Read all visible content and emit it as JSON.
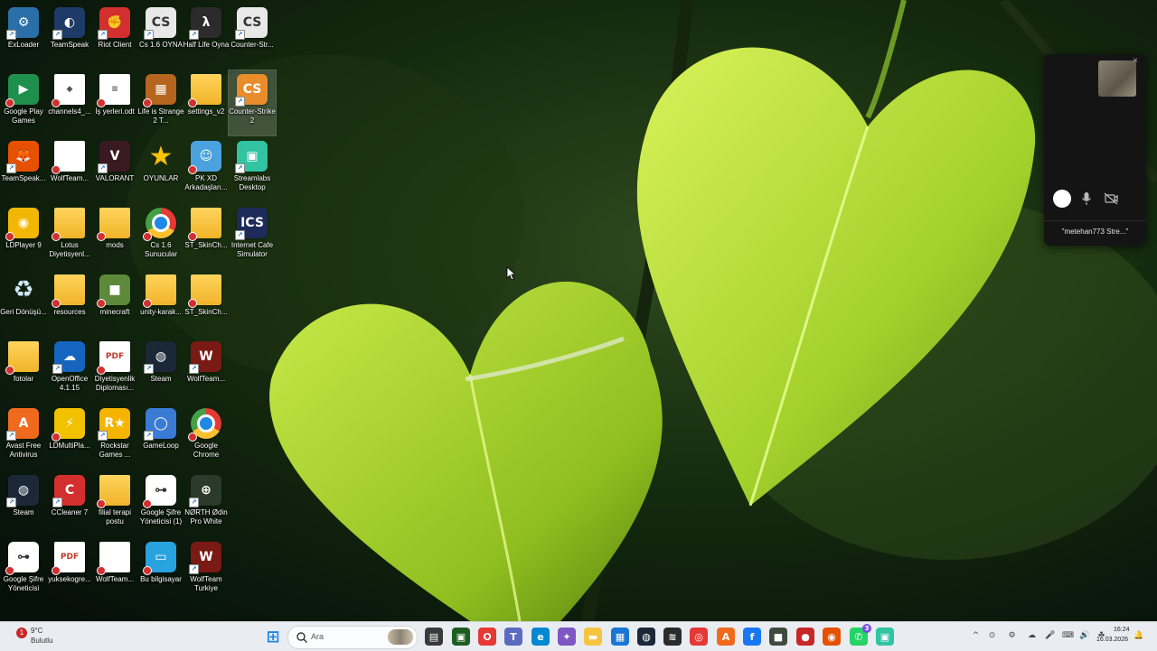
{
  "desktop": {
    "icons": [
      {
        "label": "ExLoader",
        "color": "#2a6fa8",
        "glyph": "⚙",
        "shortcut": true
      },
      {
        "label": "TeamSpeak",
        "color": "#1e3a66",
        "glyph": "◐",
        "shortcut": true
      },
      {
        "label": "Riot Client",
        "color": "#d32f2f",
        "glyph": "✊",
        "shortcut": true
      },
      {
        "label": "Cs 1.6 OYNA",
        "color": "#e8e8e8",
        "glyph": "CS",
        "shortcut": true,
        "dark": true
      },
      {
        "label": "Half Life Oyna",
        "color": "#2b2b2b",
        "glyph": "λ",
        "shortcut": true
      },
      {
        "label": "Counter-Str...",
        "color": "#e8e8e8",
        "glyph": "CS",
        "shortcut": true,
        "dark": true
      },
      {
        "label": "Google Play Games",
        "color": "#1f8f4e",
        "glyph": "▶",
        "shortcut": false
      },
      {
        "label": "channels4_...",
        "color": "#ffffff",
        "glyph": "◆",
        "doc": true
      },
      {
        "label": "İş yerleri.odt",
        "color": "#ffffff",
        "glyph": "≡",
        "doc": true
      },
      {
        "label": "Life is Strange 2 T...",
        "color": "#b5651d",
        "glyph": "▦",
        "shortcut": false
      },
      {
        "label": "settings_v2",
        "color": "#f5c542",
        "glyph": "",
        "folder": true
      },
      {
        "label": "Counter-Strike 2",
        "color": "#e88d2a",
        "glyph": "CS",
        "shortcut": true,
        "selected": true
      },
      {
        "label": "TeamSpeak...",
        "color": "#e65100",
        "glyph": "🦊",
        "shortcut": true
      },
      {
        "label": "WolfTeam...",
        "color": "#ffffff",
        "glyph": "",
        "doc": true
      },
      {
        "label": "VALORANT",
        "color": "#3a1a22",
        "glyph": "V",
        "shortcut": true
      },
      {
        "label": "OYUNLAR",
        "color": "transparent",
        "glyph": "★",
        "star": true
      },
      {
        "label": "PK XD Arkadaşları...",
        "color": "#4aa3df",
        "glyph": "☺",
        "shortcut": false
      },
      {
        "label": "Streamlabs Desktop",
        "color": "#31c3a2",
        "glyph": "▣",
        "shortcut": true
      },
      {
        "label": "LDPlayer 9",
        "color": "#f2b705",
        "glyph": "◉",
        "shortcut": false
      },
      {
        "label": "Lotus Diyetisyenl...",
        "color": "#f5c542",
        "glyph": "",
        "folder": true
      },
      {
        "label": "mods",
        "color": "#f5c542",
        "glyph": "",
        "folder": true
      },
      {
        "label": "Cs 1.6 Sunucular",
        "color": "#ffffff",
        "glyph": "◎",
        "doc": true,
        "chrome": true
      },
      {
        "label": "ST_SkinCh...",
        "color": "#f5c542",
        "glyph": "",
        "folder": true
      },
      {
        "label": "Internet Cafe Simulator",
        "color": "#1d2b5a",
        "glyph": "ICS",
        "shortcut": true
      },
      {
        "label": "Geri Dönüşü...",
        "color": "transparent",
        "glyph": "♻",
        "bin": true
      },
      {
        "label": "resources",
        "color": "#f5c542",
        "glyph": "",
        "folder": true
      },
      {
        "label": "minecraft",
        "color": "#5d8a3a",
        "glyph": "■",
        "shortcut": false
      },
      {
        "label": "unity-karak...",
        "color": "#f5c542",
        "glyph": "",
        "folder": true
      },
      {
        "label": "ST_SkinCh...",
        "color": "#f5c542",
        "glyph": "",
        "folder": true
      },
      {
        "label": "fotolar",
        "color": "#f5c542",
        "glyph": "",
        "folder": true
      },
      {
        "label": "OpenOffice 4.1.15",
        "color": "#1565c0",
        "glyph": "☁",
        "shortcut": true
      },
      {
        "label": "Diyetisyenlik Diploması...",
        "color": "#ffffff",
        "glyph": "PDF",
        "doc": true
      },
      {
        "label": "Steam",
        "color": "#1b2838",
        "glyph": "◍",
        "shortcut": true
      },
      {
        "label": "WolfTeam...",
        "color": "#7a1a14",
        "glyph": "W",
        "shortcut": true
      },
      {
        "label": "Avast Free Antivirus",
        "color": "#f06a1e",
        "glyph": "A",
        "shortcut": true
      },
      {
        "label": "LDMultiPla...",
        "color": "#f2c200",
        "glyph": "⚡",
        "shortcut": false
      },
      {
        "label": "Rockstar Games ...",
        "color": "#f5b400",
        "glyph": "R★",
        "shortcut": true
      },
      {
        "label": "GameLoop",
        "color": "#3a7bd5",
        "glyph": "◯",
        "shortcut": true
      },
      {
        "label": "Google Chrome",
        "color": "#ffffff",
        "glyph": "◎",
        "chrome": true
      },
      {
        "label": "Steam",
        "color": "#1b2838",
        "glyph": "◍",
        "shortcut": true
      },
      {
        "label": "CCleaner 7",
        "color": "#d32f2f",
        "glyph": "C",
        "shortcut": true
      },
      {
        "label": "filial terapi postu",
        "color": "#f5c542",
        "glyph": "",
        "folder": true
      },
      {
        "label": "Google Şifre Yöneticisi (1)",
        "color": "#ffffff",
        "glyph": "⊶",
        "shortcut": false,
        "dark": true
      },
      {
        "label": "NØRTH Ødin Pro White",
        "color": "#2b3a2b",
        "glyph": "⊕",
        "shortcut": true
      },
      {
        "label": "Google Şifre Yöneticisi",
        "color": "#ffffff",
        "glyph": "⊶",
        "shortcut": false,
        "dark": true
      },
      {
        "label": "yuksekogre...",
        "color": "#ffffff",
        "glyph": "PDF",
        "doc": true
      },
      {
        "label": "WolfTeam...",
        "color": "#ffffff",
        "glyph": "",
        "doc": true
      },
      {
        "label": "Bu bilgisayar",
        "color": "#29a3e0",
        "glyph": "▭",
        "shortcut": false
      },
      {
        "label": "WolfTeam Turkiye",
        "color": "#7a1a14",
        "glyph": "W",
        "shortcut": true
      }
    ]
  },
  "camera_widget": {
    "label": "\"metehan773 Stre...\"",
    "close": "×"
  },
  "taskbar": {
    "weather": {
      "temp": "9°C",
      "desc": "Bulutlu",
      "badge": "1"
    },
    "search_placeholder": "Ara",
    "pinned": [
      {
        "name": "start-button",
        "color": "#1e88e5",
        "glyph": "⊞"
      },
      {
        "name": "task-view-icon",
        "color": "#3a3a3a",
        "glyph": "▤"
      },
      {
        "name": "xbox-icon",
        "color": "#1b5e20",
        "glyph": "▣"
      },
      {
        "name": "opera-icon",
        "color": "#e53935",
        "glyph": "O"
      },
      {
        "name": "teams-icon",
        "color": "#5c6bc0",
        "glyph": "T"
      },
      {
        "name": "edge-icon",
        "color": "#0288d1",
        "glyph": "e"
      },
      {
        "name": "copilot-icon",
        "color": "#7e57c2",
        "glyph": "✦"
      },
      {
        "name": "file-explorer-icon",
        "color": "#f5c542",
        "glyph": "▬"
      },
      {
        "name": "store-icon",
        "color": "#1976d2",
        "glyph": "▦"
      },
      {
        "name": "steam-icon",
        "color": "#1b2838",
        "glyph": "◍"
      },
      {
        "name": "epic-icon",
        "color": "#2b2b2b",
        "glyph": "≋"
      },
      {
        "name": "chrome-icon",
        "color": "#e53935",
        "glyph": "◎"
      },
      {
        "name": "avast-icon",
        "color": "#f06a1e",
        "glyph": "A"
      },
      {
        "name": "facebook-icon",
        "color": "#1877f2",
        "glyph": "f"
      },
      {
        "name": "box-icon",
        "color": "#3e4a3e",
        "glyph": "■"
      },
      {
        "name": "lg-icon",
        "color": "#c62828",
        "glyph": "●"
      },
      {
        "name": "firefox-icon",
        "color": "#e65100",
        "glyph": "◉"
      },
      {
        "name": "whatsapp-icon",
        "color": "#25d366",
        "glyph": "✆",
        "badge": "3"
      },
      {
        "name": "streamlabs-icon",
        "color": "#31c3a2",
        "glyph": "▣"
      }
    ],
    "tray": [
      "^",
      "⊙",
      "⚙",
      "☁",
      "🎤",
      "⌨",
      "🔊",
      "☘",
      "🔔"
    ],
    "clock": {
      "time": "16:24",
      "date": "16.03.2026"
    }
  }
}
